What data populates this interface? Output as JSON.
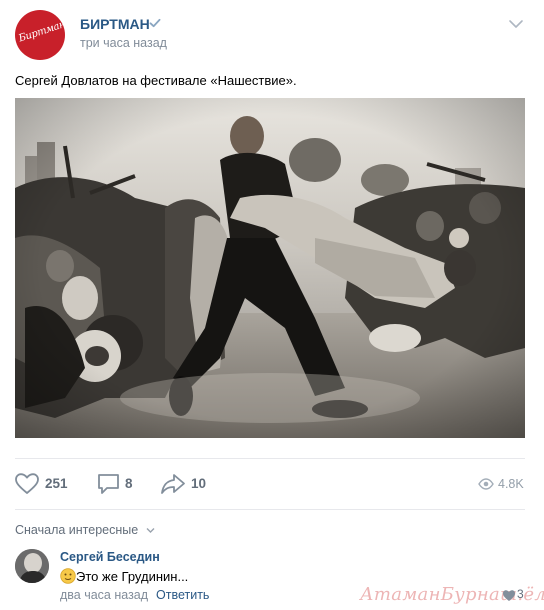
{
  "post": {
    "author": "БИРТМАН",
    "time": "три часа назад",
    "text": "Сергей Довлатов на фестивале «Нашествие».",
    "logo_text": "Биртман"
  },
  "actions": {
    "likes": "251",
    "comments": "8",
    "shares": "10",
    "views": "4.8K"
  },
  "comments_section": {
    "sort_label": "Сначала интересные",
    "comment": {
      "author": "Сергей Беседин",
      "text": "Это же Грудинин...",
      "time": "два часа назад",
      "reply_label": "Ответить",
      "likes": "3"
    }
  },
  "watermark": "АтаманБурнаш.ёлка",
  "colors": {
    "link": "#2a5885",
    "muted": "#818c99",
    "brand": "#c8202a"
  },
  "icons": [
    "verified-icon",
    "chevron-down-icon",
    "heart-icon",
    "comment-icon",
    "share-icon",
    "eye-icon",
    "emoji-icon"
  ]
}
